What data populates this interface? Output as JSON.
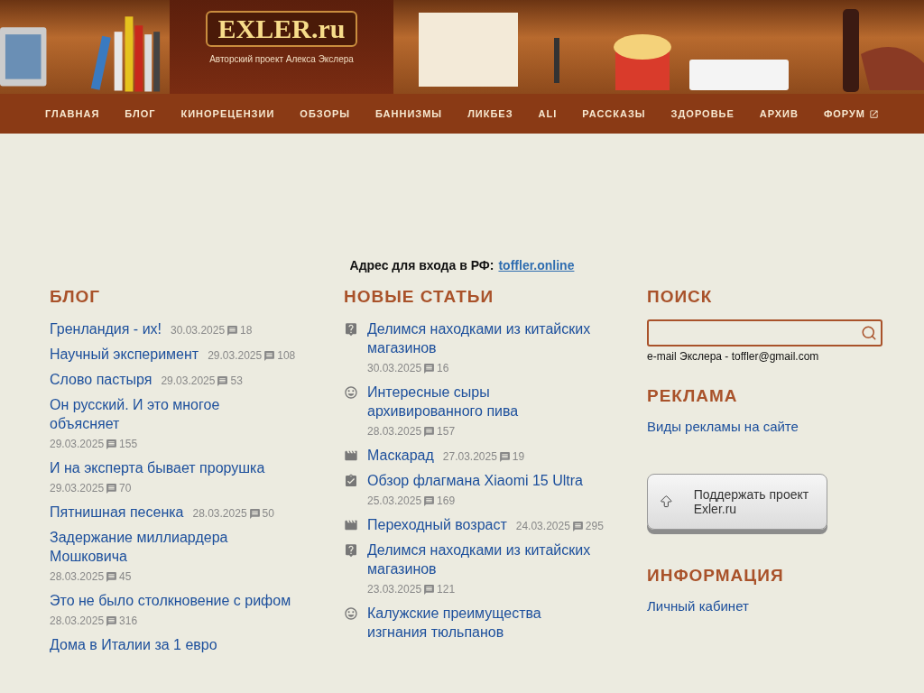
{
  "header": {
    "logo": "EXLER.ru",
    "tagline": "Авторский проект Алекса Экслера"
  },
  "nav": [
    {
      "label": "ГЛАВНАЯ",
      "external": false
    },
    {
      "label": "БЛОГ",
      "external": false
    },
    {
      "label": "КИНОРЕЦЕНЗИИ",
      "external": false
    },
    {
      "label": "ОБЗОРЫ",
      "external": false
    },
    {
      "label": "БАННИЗМЫ",
      "external": false
    },
    {
      "label": "ЛИКБЕЗ",
      "external": false
    },
    {
      "label": "ALI",
      "external": false
    },
    {
      "label": "РАССКАЗЫ",
      "external": false
    },
    {
      "label": "ЗДОРОВЬЕ",
      "external": false
    },
    {
      "label": "АРХИВ",
      "external": false
    },
    {
      "label": "ФОРУМ",
      "external": true
    }
  ],
  "notice": {
    "label": "Адрес для входа в РФ:",
    "link": "toffler.online"
  },
  "blog": {
    "title": "БЛОГ",
    "items": [
      {
        "title": "Гренландия - их!",
        "date": "30.03.2025",
        "comments": "18"
      },
      {
        "title": "Научный эксперимент",
        "date": "29.03.2025",
        "comments": "108"
      },
      {
        "title": "Слово пастыря",
        "date": "29.03.2025",
        "comments": "53"
      },
      {
        "title": "Он русский. И это многое объясняет",
        "date": "29.03.2025",
        "comments": "155"
      },
      {
        "title": "И на эксперта бывает прорушка",
        "date": "29.03.2025",
        "comments": "70"
      },
      {
        "title": "Пятнишная песенка",
        "date": "28.03.2025",
        "comments": "50"
      },
      {
        "title": "Задержание миллиардера Мошковича",
        "date": "28.03.2025",
        "comments": "45"
      },
      {
        "title": "Это не было столкновение с рифом",
        "date": "28.03.2025",
        "comments": "316"
      },
      {
        "title": "Дома в Италии за 1 евро"
      }
    ]
  },
  "articles": {
    "title": "НОВЫЕ СТАТЬИ",
    "items": [
      {
        "kind": "question",
        "title": "Делимся находками из китайских магазинов",
        "date": "30.03.2025",
        "comments": "16"
      },
      {
        "kind": "smile",
        "title": "Интересные сыры архивированного пива",
        "date": "28.03.2025",
        "comments": "157"
      },
      {
        "kind": "movie",
        "title": "Маскарад",
        "date": "27.03.2025",
        "comments": "19"
      },
      {
        "kind": "review",
        "title": "Обзор флагмана Xiaomi 15 Ultra",
        "date": "25.03.2025",
        "comments": "169"
      },
      {
        "kind": "movie",
        "title": "Переходный возраст",
        "date": "24.03.2025",
        "comments": "295"
      },
      {
        "kind": "question",
        "title": "Делимся находками из китайских магазинов",
        "date": "23.03.2025",
        "comments": "121"
      },
      {
        "kind": "smile",
        "title": "Калужские преимущества изгнания тюльпанов"
      }
    ]
  },
  "sidebar": {
    "search_title": "ПОИСК",
    "email": "e-mail Экслера - toffler@gmail.com",
    "ads_title": "РЕКЛАМА",
    "ads_link": "Виды рекламы на сайте",
    "support_button": "Поддержать проект Exler.ru",
    "info_title": "ИНФОРМАЦИЯ",
    "info_link": "Личный кабинет"
  }
}
